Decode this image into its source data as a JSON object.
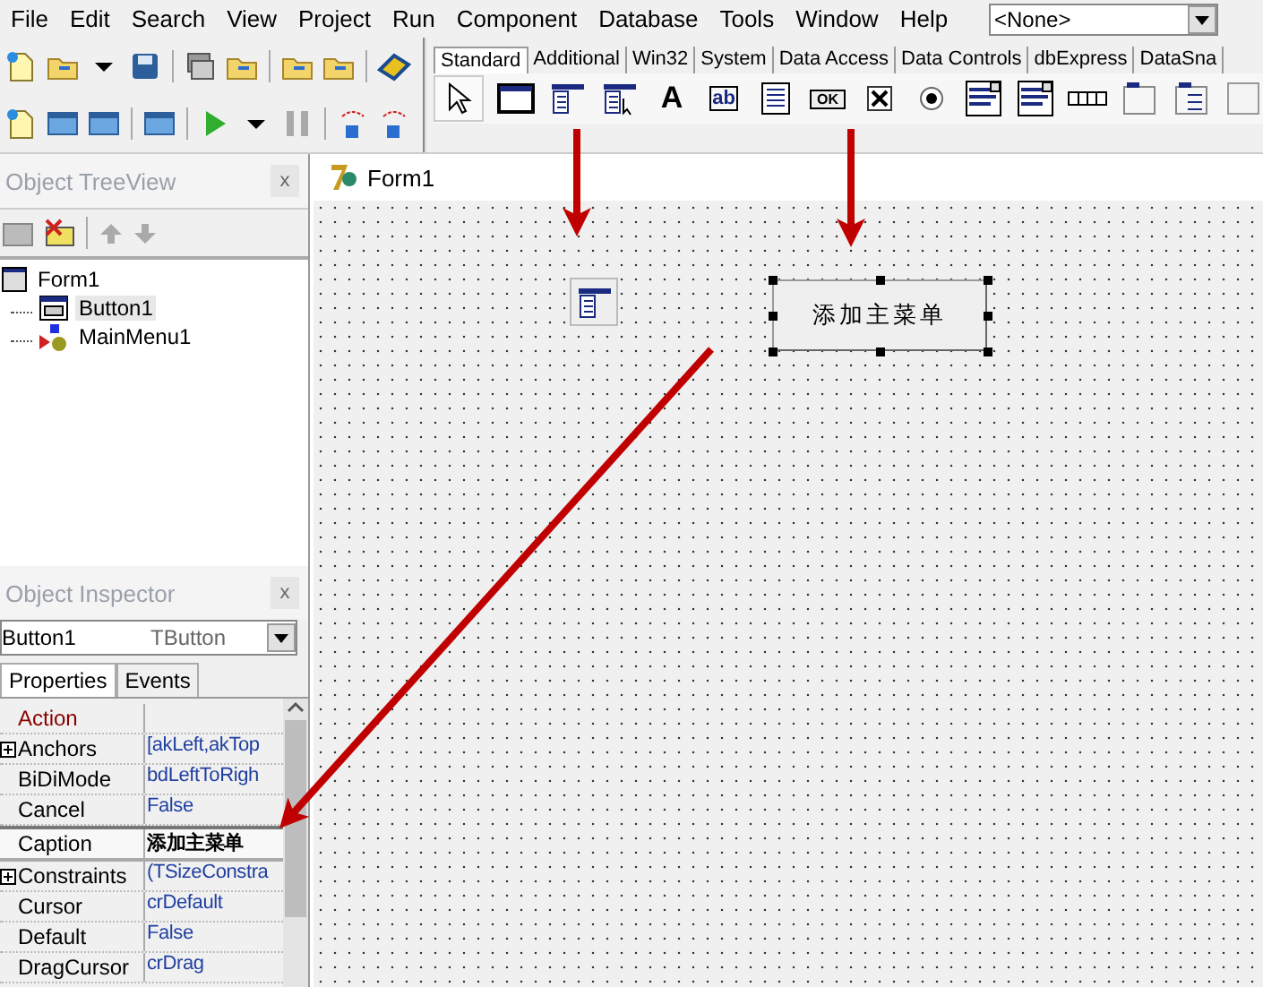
{
  "menu": [
    "File",
    "Edit",
    "Search",
    "View",
    "Project",
    "Run",
    "Component",
    "Database",
    "Tools",
    "Window",
    "Help"
  ],
  "component_combo": {
    "value": "<None>"
  },
  "palette": {
    "tabs": [
      {
        "label": "Standard",
        "selected": true
      },
      {
        "label": "Additional",
        "selected": false
      },
      {
        "label": "Win32",
        "selected": false
      },
      {
        "label": "System",
        "selected": false
      },
      {
        "label": "Data Access",
        "selected": false
      },
      {
        "label": "Data Controls",
        "selected": false
      },
      {
        "label": "dbExpress",
        "selected": false
      },
      {
        "label": "DataSna",
        "selected": false
      }
    ],
    "items": [
      {
        "kind": "pointer",
        "selected": true
      },
      {
        "kind": "frame",
        "selected": false
      },
      {
        "kind": "mainmenu",
        "selected": false
      },
      {
        "kind": "popupmenu",
        "selected": false
      },
      {
        "kind": "label",
        "glyph": "A",
        "selected": false
      },
      {
        "kind": "edit",
        "glyph": "ab",
        "selected": false
      },
      {
        "kind": "memo",
        "selected": false
      },
      {
        "kind": "button",
        "glyph": "OK",
        "selected": false
      },
      {
        "kind": "checkbox",
        "selected": false
      },
      {
        "kind": "radio",
        "selected": false
      },
      {
        "kind": "listbox",
        "selected": false
      },
      {
        "kind": "combobox",
        "selected": false
      },
      {
        "kind": "scrollbar",
        "selected": false
      },
      {
        "kind": "groupbox",
        "selected": false
      },
      {
        "kind": "radiogroup",
        "selected": false
      },
      {
        "kind": "panel",
        "selected": false
      }
    ]
  },
  "treeview": {
    "title": "Object TreeView",
    "close": "x",
    "nodes": [
      {
        "label": "Form1",
        "kind": "form",
        "selected": false,
        "children": [
          {
            "label": "Button1",
            "kind": "button",
            "selected": true
          },
          {
            "label": "MainMenu1",
            "kind": "mainmenu",
            "selected": false
          }
        ]
      }
    ]
  },
  "inspector": {
    "title": "Object Inspector",
    "close": "x",
    "object_name": "Button1",
    "object_type": "TButton",
    "tabs": [
      {
        "label": "Properties",
        "selected": true
      },
      {
        "label": "Events",
        "selected": false
      }
    ],
    "rows": [
      {
        "name": "Action",
        "value": "",
        "kind": "reference",
        "expandable": false,
        "selected": false
      },
      {
        "name": "Anchors",
        "value": "[akLeft,akTop",
        "kind": "property",
        "expandable": true,
        "selected": false
      },
      {
        "name": "BiDiMode",
        "value": "bdLeftToRigh",
        "kind": "property",
        "expandable": false,
        "selected": false
      },
      {
        "name": "Cancel",
        "value": "False",
        "kind": "property",
        "expandable": false,
        "selected": false
      },
      {
        "name": "Caption",
        "value": "添加主菜单",
        "kind": "property",
        "expandable": false,
        "selected": true
      },
      {
        "name": "Constraints",
        "value": "(TSizeConstra",
        "kind": "property",
        "expandable": true,
        "selected": false
      },
      {
        "name": "Cursor",
        "value": "crDefault",
        "kind": "property",
        "expandable": false,
        "selected": false
      },
      {
        "name": "Default",
        "value": "False",
        "kind": "property",
        "expandable": false,
        "selected": false
      },
      {
        "name": "DragCursor",
        "value": "crDrag",
        "kind": "property",
        "expandable": false,
        "selected": false
      }
    ]
  },
  "form": {
    "title": "Form1",
    "components": [
      {
        "kind": "mainmenu",
        "selected": false
      },
      {
        "kind": "button",
        "caption": "添加主菜单",
        "selected": true
      }
    ]
  }
}
